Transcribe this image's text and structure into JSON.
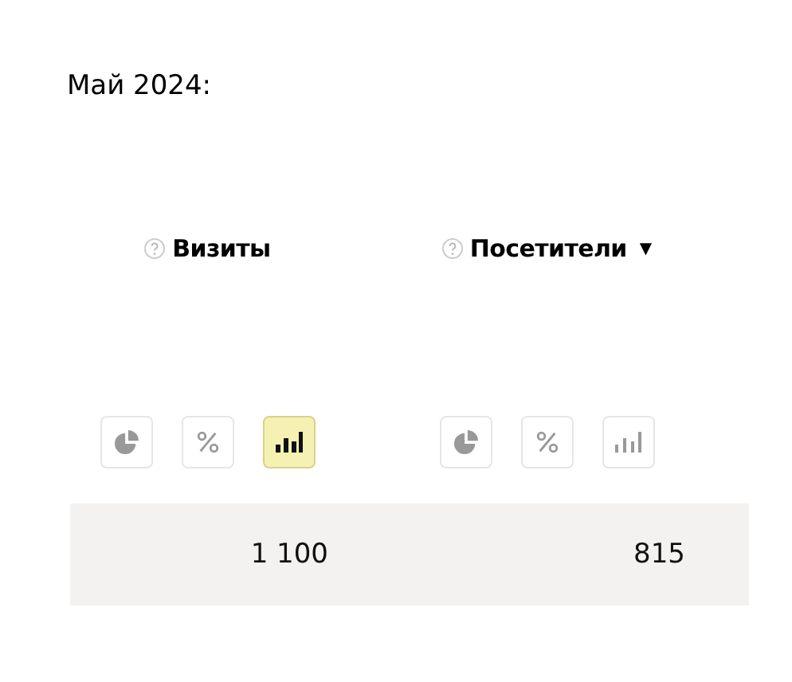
{
  "title": "Май 2024:",
  "columns": [
    {
      "label": "Визиты",
      "buttons": [
        {
          "kind": "pie",
          "selected": false
        },
        {
          "kind": "percent",
          "selected": false
        },
        {
          "kind": "bars",
          "selected": true
        }
      ],
      "value": "1 100"
    },
    {
      "label": "Посетители",
      "sort_mark": "▼",
      "buttons": [
        {
          "kind": "pie",
          "selected": false
        },
        {
          "kind": "percent",
          "selected": false
        },
        {
          "kind": "bars",
          "selected": false
        }
      ],
      "value": "815"
    }
  ]
}
